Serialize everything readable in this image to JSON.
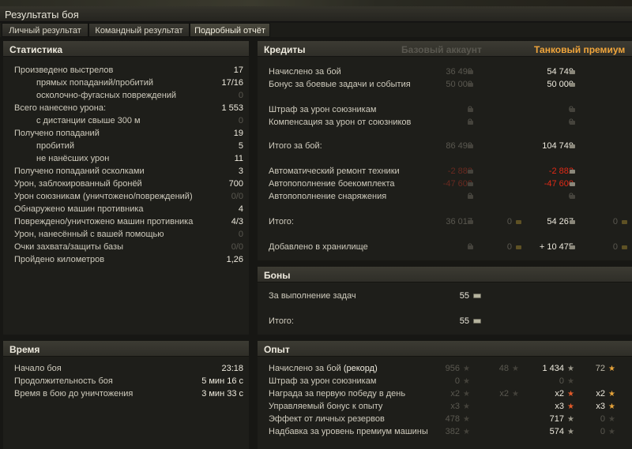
{
  "window": {
    "title": "Результаты боя"
  },
  "tabs": [
    "Личный результат",
    "Командный результат",
    "Подробный отчёт"
  ],
  "stats": {
    "header": "Статистика",
    "rows": [
      {
        "label": "Произведено выстрелов",
        "value": "17"
      },
      {
        "label": "прямых попаданий/пробитий",
        "value": "17/16"
      },
      {
        "label": "осколочно-фугасных повреждений",
        "value": "0"
      },
      {
        "label": "Всего нанесено урона:",
        "value": "1 553"
      },
      {
        "label": "с дистанции свыше 300 м",
        "value": "0"
      },
      {
        "label": "Получено попаданий",
        "value": "19"
      },
      {
        "label": "пробитий",
        "value": "5"
      },
      {
        "label": "не нанёсших урон",
        "value": "11"
      },
      {
        "label": "Получено попаданий осколками",
        "value": "3"
      },
      {
        "label": "Урон, заблокированный бронёй",
        "value": "700"
      },
      {
        "label": "Урон союзникам (уничтожено/повреждений)",
        "value": "0/0"
      },
      {
        "label": "Обнаружено машин противника",
        "value": "4"
      },
      {
        "label": "Повреждено/уничтожено машин противника",
        "value": "4/3"
      },
      {
        "label": "Урон, нанесённый с вашей помощью",
        "value": "0"
      },
      {
        "label": "Очки захвата/защиты базы",
        "value": "0/0"
      },
      {
        "label": "Пройдено километров",
        "value": "1,26"
      }
    ]
  },
  "time": {
    "header": "Время",
    "rows": [
      {
        "label": "Начало боя",
        "value": "23:18"
      },
      {
        "label": "Продолжительность боя",
        "value": "5 мин 16 с"
      },
      {
        "label": "Время в бою до уничтожения",
        "value": "3 мин 33 с"
      }
    ]
  },
  "credits": {
    "header": "Кредиты",
    "col_base": "Базовый аккаунт",
    "col_premium": "Танковый премиум",
    "rows": [
      {
        "label": "Начислено за бой",
        "base": "36 499",
        "prem": "54 749"
      },
      {
        "label": "Бонус за боевые задачи и события",
        "base": "50 000",
        "prem": "50 000"
      },
      {
        "label": "Штраф за урон союзникам",
        "base": "0",
        "prem": "0"
      },
      {
        "label": "Компенсация за урон от союзников",
        "base": "0",
        "prem": "0"
      },
      {
        "label": "Итого за бой:",
        "base": "86 499",
        "prem": "104 749"
      },
      {
        "label": "Автоматический ремонт техники",
        "base": "-2 882",
        "prem": "-2 882"
      },
      {
        "label": "Автопополнение боекомплекта",
        "base": "-47 600",
        "prem": "-47 600"
      },
      {
        "label": "Автопополнение снаряжения",
        "base": "0",
        "prem": "0"
      },
      {
        "label": "Итого:",
        "base": "36 017",
        "base_gold": "0",
        "prem": "54 267",
        "prem_gold": "0"
      },
      {
        "label": "Добавлено в хранилище",
        "base": "0",
        "base_gold": "0",
        "prem": "+ 10 475",
        "prem_gold": "0"
      }
    ]
  },
  "bonds": {
    "header": "Боны",
    "rows": [
      {
        "label": "За выполнение задач",
        "value": "55"
      },
      {
        "label": "Итого:",
        "value": "55"
      }
    ]
  },
  "xp": {
    "header": "Опыт",
    "rows": [
      {
        "label": "Начислено за бой",
        "label_highlight": "(рекорд)",
        "base": "956",
        "base_free": "48",
        "prem": "1 434",
        "prem_free": "72"
      },
      {
        "label": "Штраф за урон союзникам",
        "base": "0",
        "base_free": "",
        "prem": "0",
        "prem_free": ""
      },
      {
        "label": "Награда за первую победу в день",
        "base": "x2",
        "base_free": "x2",
        "prem": "x2",
        "prem_free": "x2"
      },
      {
        "label": "Управляемый бонус к опыту",
        "base": "x3",
        "base_free": "",
        "prem": "x3",
        "prem_free": "x3"
      },
      {
        "label": "Эффект от личных резервов",
        "base": "478",
        "base_free": "",
        "prem": "717",
        "prem_free": "0"
      },
      {
        "label": "Надбавка за уровень премиум машины",
        "base": "382",
        "base_free": "",
        "prem": "574",
        "prem_free": "0"
      }
    ]
  },
  "colors": {
    "premium_header": "#f0a53b",
    "negative": "#e02a16",
    "background": "#171714"
  },
  "icons": [
    "credits-icon",
    "gold-icon",
    "bond-icon",
    "xp-star-icon",
    "free-xp-star-icon"
  ]
}
